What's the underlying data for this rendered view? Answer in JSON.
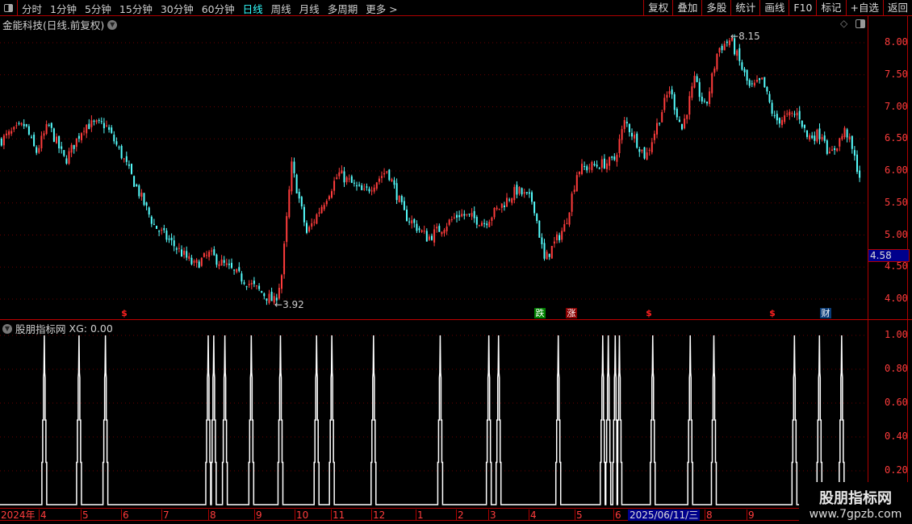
{
  "toolbar": {
    "periods": [
      "分时",
      "1分钟",
      "5分钟",
      "15分钟",
      "30分钟",
      "60分钟",
      "日线",
      "周线",
      "月线",
      "多周期",
      "更多 >"
    ],
    "active_period": "日线",
    "actions": [
      "复权",
      "叠加",
      "多股",
      "统计",
      "画线",
      "F10",
      "标记",
      "+自选",
      "返回"
    ]
  },
  "main": {
    "title": "金能科技(日线.前复权)",
    "current_price_label": "4.58",
    "high_label": "8.15",
    "low_label": "3.92",
    "markers": [
      {
        "text": "$",
        "color": "#ff2020"
      },
      {
        "text": "跌",
        "color": "#008000"
      },
      {
        "text": "涨",
        "color": "#8b0000"
      },
      {
        "text": "$",
        "color": "#ff2020"
      },
      {
        "text": "$",
        "color": "#ff2020"
      },
      {
        "text": "财",
        "color": "#0a3c78"
      }
    ]
  },
  "indicator": {
    "title": "股朋指标网",
    "value_label": "XG: 0.00"
  },
  "watermark": {
    "name": "股朋指标网",
    "url": "www.7gpzb.com"
  },
  "colors": {
    "up": "#ff3c3c",
    "down": "#54fcfc",
    "axis": "#b00000",
    "signal": "#ffffff"
  },
  "x_axis": {
    "year_label": "2024年",
    "months": [
      "4",
      "5",
      "6",
      "7",
      "8",
      "9",
      "10",
      "11",
      "12",
      "1",
      "2",
      "3",
      "4",
      "5",
      "6",
      "8",
      "9"
    ],
    "cursor_date": "2025/06/11/三"
  },
  "chart_data": [
    {
      "type": "candlestick",
      "y_axis": {
        "ticks": [
          "8.00",
          "7.50",
          "7.00",
          "6.50",
          "6.00",
          "5.50",
          "5.00",
          "4.50",
          "4.00"
        ],
        "range": [
          3.8,
          8.2
        ]
      },
      "close_path": [
        [
          "2024-03-04",
          6.47
        ],
        [
          "2024-03-22",
          6.72
        ],
        [
          "2024-03-30",
          6.28
        ],
        [
          "2024-04-08",
          6.72
        ],
        [
          "2024-04-20",
          6.15
        ],
        [
          "2024-05-04",
          6.72
        ],
        [
          "2024-05-19",
          6.72
        ],
        [
          "2024-05-30",
          6.28
        ],
        [
          "2024-06-23",
          5.15
        ],
        [
          "2024-07-22",
          4.52
        ],
        [
          "2024-08-02",
          4.7
        ],
        [
          "2024-08-25",
          4.33
        ],
        [
          "2024-09-18",
          3.95
        ],
        [
          "2024-09-23",
          4.39
        ],
        [
          "2024-09-30",
          6.09
        ],
        [
          "2024-10-11",
          5.02
        ],
        [
          "2024-11-03",
          5.96
        ],
        [
          "2024-11-21",
          5.65
        ],
        [
          "2024-12-08",
          6.02
        ],
        [
          "2024-12-20",
          5.33
        ],
        [
          "2025-01-06",
          4.95
        ],
        [
          "2025-01-29",
          5.33
        ],
        [
          "2025-02-16",
          5.2
        ],
        [
          "2025-03-11",
          5.7
        ],
        [
          "2025-03-23",
          5.52
        ],
        [
          "2025-03-31",
          4.6
        ],
        [
          "2025-04-15",
          5.15
        ],
        [
          "2025-04-24",
          6.02
        ],
        [
          "2025-05-20",
          6.15
        ],
        [
          "2025-05-28",
          6.78
        ],
        [
          "2025-06-12",
          6.21
        ],
        [
          "2025-06-29",
          7.28
        ],
        [
          "2025-07-08",
          6.65
        ],
        [
          "2025-07-17",
          7.4
        ],
        [
          "2025-07-25",
          6.97
        ],
        [
          "2025-08-03",
          7.9
        ],
        [
          "2025-08-12",
          8.05
        ],
        [
          "2025-08-26",
          7.28
        ],
        [
          "2025-09-04",
          7.4
        ],
        [
          "2025-09-13",
          6.78
        ],
        [
          "2025-09-30",
          6.9
        ],
        [
          "2025-10-06",
          6.53
        ],
        [
          "2025-10-18",
          6.59
        ],
        [
          "2025-10-22",
          6.21
        ],
        [
          "2025-11-03",
          6.65
        ],
        [
          "2025-11-13",
          5.92
        ]
      ]
    },
    {
      "type": "line",
      "name": "XG",
      "y_axis": {
        "ticks": [
          "1.00",
          "0.80",
          "0.60",
          "0.40",
          "0.20"
        ],
        "range": [
          0,
          1
        ]
      },
      "signal_dates": [
        "2024-04-05",
        "2024-04-30",
        "2024-05-19",
        "2024-08-01",
        "2024-08-05",
        "2024-08-13",
        "2024-09-01",
        "2024-09-22",
        "2024-10-18",
        "2024-10-29",
        "2024-11-28",
        "2025-01-15",
        "2025-02-19",
        "2025-02-26",
        "2025-04-10",
        "2025-05-12",
        "2025-05-16",
        "2025-05-21",
        "2025-05-24",
        "2025-06-17",
        "2025-07-14",
        "2025-07-31",
        "2025-09-27",
        "2025-10-15",
        "2025-10-31"
      ]
    }
  ]
}
